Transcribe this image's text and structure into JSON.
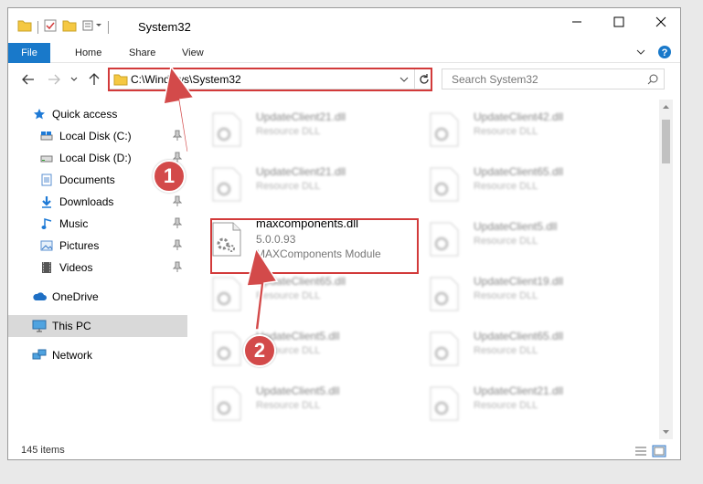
{
  "window": {
    "title": "System32"
  },
  "ribbon": {
    "tabs": [
      "File",
      "Home",
      "Share",
      "View"
    ]
  },
  "address": {
    "path": "C:\\Windows\\System32"
  },
  "search": {
    "placeholder": "Search System32"
  },
  "sidebar": {
    "items": [
      {
        "label": "Quick access",
        "icon": "star-icon"
      },
      {
        "label": "Local Disk (C:)",
        "icon": "drive-icon"
      },
      {
        "label": "Local Disk (D:)",
        "icon": "drive-icon"
      },
      {
        "label": "Documents",
        "icon": "documents-icon"
      },
      {
        "label": "Downloads",
        "icon": "download-icon"
      },
      {
        "label": "Music",
        "icon": "music-icon"
      },
      {
        "label": "Pictures",
        "icon": "pictures-icon"
      },
      {
        "label": "Videos",
        "icon": "videos-icon"
      },
      {
        "label": "OneDrive",
        "icon": "cloud-icon"
      },
      {
        "label": "This PC",
        "icon": "computer-icon"
      },
      {
        "label": "Network",
        "icon": "network-icon"
      }
    ]
  },
  "files": [
    {
      "name": "UpdateClient21.dll",
      "desc": "Resource DLL"
    },
    {
      "name": "UpdateClient42.dll",
      "desc": "Resource DLL"
    },
    {
      "name": "UpdateClient21.dll",
      "desc": "Resource DLL"
    },
    {
      "name": "UpdateClient65.dll",
      "desc": "Resource DLL"
    },
    {
      "name": "maxcomponents.dll",
      "version": "5.0.0.93",
      "desc": "MAXComponents Module"
    },
    {
      "name": "UpdateClient5.dll",
      "desc": "Resource DLL"
    },
    {
      "name": "UpdateClient65.dll",
      "desc": "Resource DLL"
    },
    {
      "name": "UpdateClient19.dll",
      "desc": "Resource DLL"
    },
    {
      "name": "UpdateClient5.dll",
      "desc": "Resource DLL"
    },
    {
      "name": "UpdateClient65.dll",
      "desc": "Resource DLL"
    },
    {
      "name": "UpdateClient5.dll",
      "desc": "Resource DLL"
    },
    {
      "name": "UpdateClient21.dll",
      "desc": "Resource DLL"
    }
  ],
  "status": {
    "count": "145 items"
  },
  "annotations": {
    "badge1": "1",
    "badge2": "2"
  },
  "colors": {
    "highlight": "#d23a3a",
    "accent": "#1979ca",
    "badge": "#d34a4a"
  }
}
